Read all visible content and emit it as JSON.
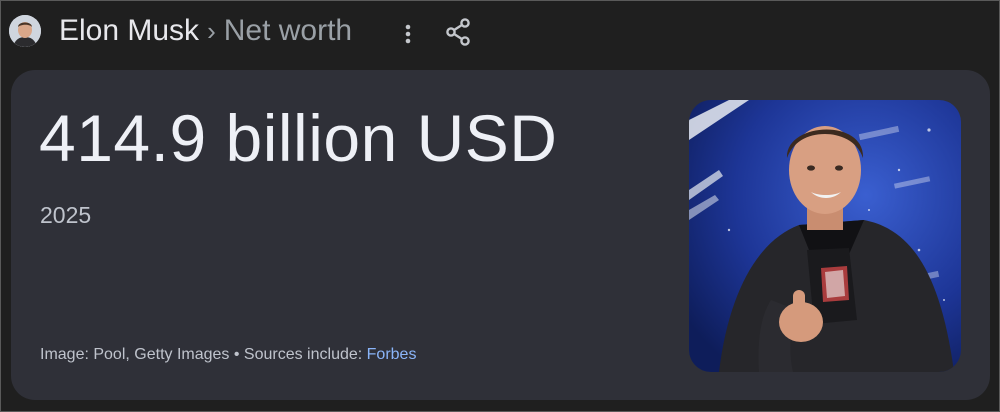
{
  "header": {
    "entity": "Elon Musk",
    "separator": "›",
    "attribute": "Net worth",
    "more_icon": "more-vert-icon",
    "share_icon": "share-icon"
  },
  "card": {
    "value": "414.9 billion USD",
    "year": "2025",
    "credit_text": "Image: Pool, Getty Images • Sources include: ",
    "source_link": "Forbes"
  },
  "colors": {
    "page_background": "#1f1f1f",
    "card_background": "#2f3038",
    "primary_text": "#eef0f6",
    "secondary_text": "#9aa0a6",
    "link": "#8ab4f8"
  }
}
